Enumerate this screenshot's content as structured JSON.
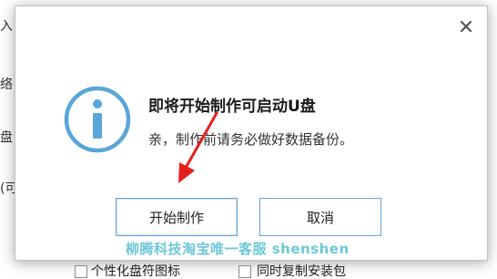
{
  "background": {
    "left_fragments": [
      "入",
      "络",
      "盘",
      "(可"
    ],
    "bottom": {
      "option1_label": "个性化盘符图标",
      "option2_label": "同时复制安装包"
    }
  },
  "dialog": {
    "title": "即将开始制作可启动U盘",
    "message": "亲，制作前请务必做好数据备份。",
    "start_button": "开始制作",
    "cancel_button": "取消",
    "close_symbol": "✕"
  },
  "icons": {
    "info": "info-icon",
    "close": "close-icon",
    "annotation": "red-arrow"
  },
  "colors": {
    "info_icon": "#5aa6d9",
    "button_border": "#66a4d8",
    "annotation_arrow": "#e6201f"
  },
  "watermark": "柳腾科技淘宝唯一客服 shenshen"
}
